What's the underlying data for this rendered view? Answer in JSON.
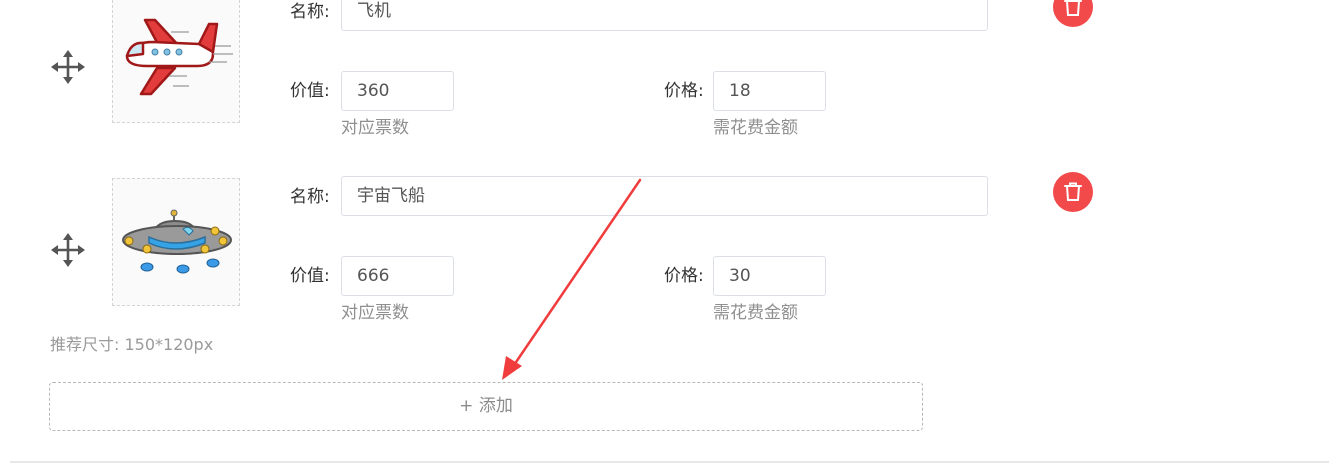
{
  "items": [
    {
      "name_label": "名称:",
      "name_value": "飞机",
      "value_label": "价值:",
      "value_value": "360",
      "value_hint": "对应票数",
      "price_label": "价格:",
      "price_value": "18",
      "price_hint": "需花费金额",
      "image_icon": "airplane-image"
    },
    {
      "name_label": "名称:",
      "name_value": "宇宙飞船",
      "value_label": "价值:",
      "value_value": "666",
      "value_hint": "对应票数",
      "price_label": "价格:",
      "price_value": "30",
      "price_hint": "需花费金额",
      "image_icon": "spaceship-image"
    }
  ],
  "size_tip": "推荐尺寸: 150*120px",
  "add_button_label": "+ 添加",
  "colors": {
    "delete": "#f24a4a",
    "arrow": "#f03c3c",
    "border": "#dcdfe6"
  }
}
